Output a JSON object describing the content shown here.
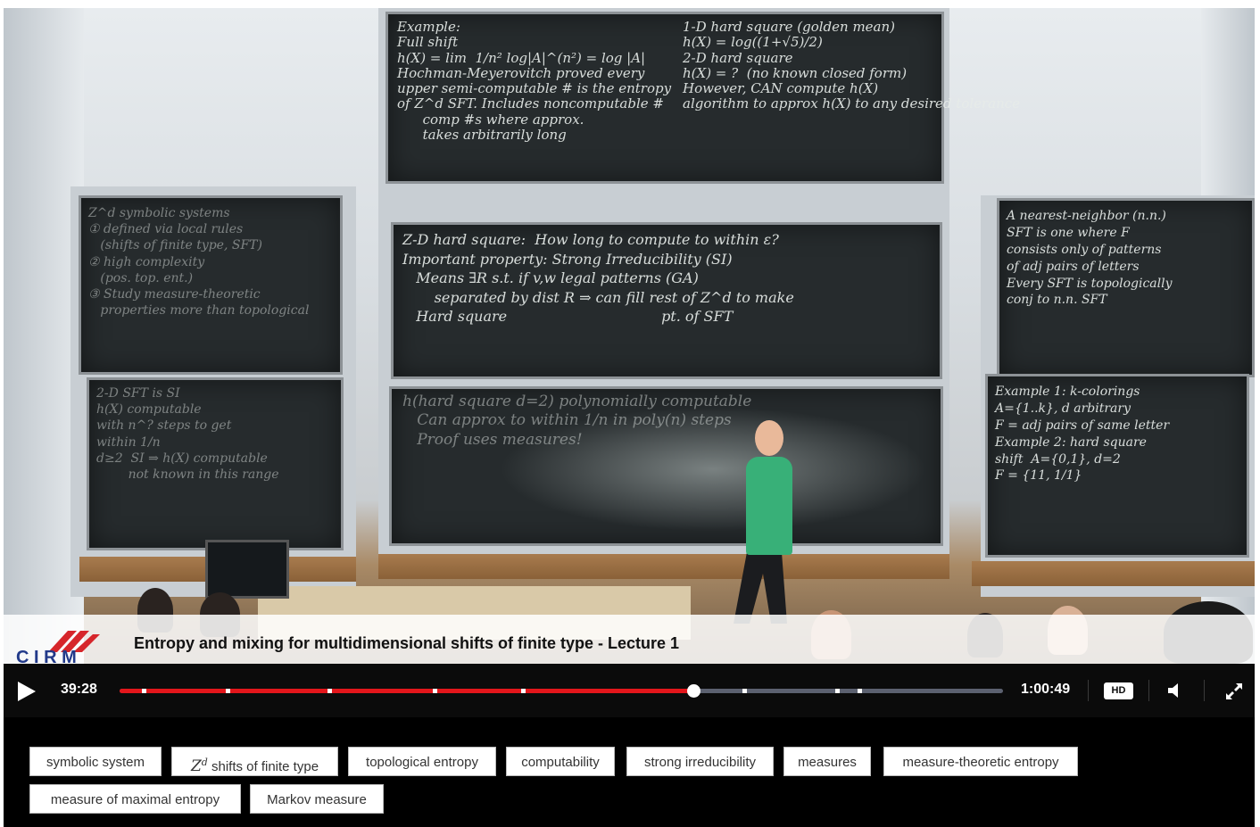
{
  "video": {
    "title": "Entropy and mixing for multidimensional shifts of finite type - Lecture 1",
    "logo_text": "C I R M",
    "boards": {
      "top_center": "Example:\nFull shift\nh(X) = lim  1/n² log|A|^(n²) = log |A|\nHochman-Meyerovitch proved every\nupper semi-computable # is the entropy\nof Z^d SFT. Includes noncomputable #\n      comp #s where approx.\n      takes arbitrarily long",
      "top_center_right": "1-D hard square (golden mean)\nh(X) = log((1+√5)/2)\n2-D hard square\nh(X) = ?  (no known closed form)\nHowever, CAN compute h(X)\nalgorithm to approx h(X) to any desired tolerance",
      "mid_center": "Z-D hard square:  How long to compute to within ε?\nImportant property: Strong Irreducibility (SI)\n   Means ∃R s.t. if v,w legal patterns (GA)\n       separated by dist R ⇒ can fill rest of Z^d to make\n   Hard square                                  pt. of SFT",
      "bottom_center": "h(hard square d=2) polynomially computable\n   Can approx to within 1/n in poly(n) steps\n   Proof uses measures!",
      "left_top": "Z^d symbolic systems\n① defined via local rules\n   (shifts of finite type, SFT)\n② high complexity\n   (pos. top. ent.)\n③ Study measure-theoretic\n   properties more than topological",
      "left_bottom": "2-D SFT is SI\nh(X) computable\nwith n^? steps to get\nwithin 1/n\nd≥2  SI ⇒ h(X) computable\n        not known in this range",
      "right_top": "A nearest-neighbor (n.n.)\nSFT is one where F\nconsists only of patterns\nof adj pairs of letters\nEvery SFT is topologically\nconj to n.n. SFT",
      "right_bottom": "Example 1: k-colorings\nA={1..k}, d arbitrary\nF = adj pairs of same letter\nExample 2: hard square\nshift  A={0,1}, d=2\nF = {11, 1/1}"
    }
  },
  "controls": {
    "current_time": "39:28",
    "total_time": "1:00:49",
    "progress_fraction": 0.6495,
    "chapter_markers": [
      0.025,
      0.12,
      0.235,
      0.355,
      0.455,
      0.705,
      0.81,
      0.835
    ],
    "hd_label": "HD",
    "icons": [
      "play-icon",
      "volume-icon",
      "fullscreen-icon"
    ],
    "colors": {
      "progress": "#e3161b",
      "track": "#5c6170",
      "bar_bg": "#0b0b0b"
    }
  },
  "tags": [
    {
      "label": "symbolic system"
    },
    {
      "label_math": "Z",
      "label_sup": "d",
      "label": " shifts of finite type"
    },
    {
      "label": "topological entropy"
    },
    {
      "label": "computability"
    },
    {
      "label": "strong irreducibility"
    },
    {
      "label": "measures"
    },
    {
      "label": "measure-theoretic entropy"
    },
    {
      "label": "measure of maximal entropy"
    },
    {
      "label": "Markov measure"
    }
  ]
}
